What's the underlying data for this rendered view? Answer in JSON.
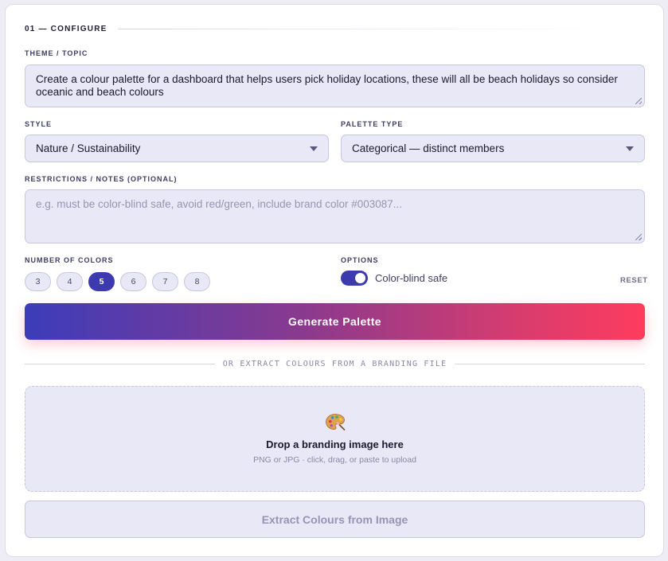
{
  "section": {
    "title": "01 — CONFIGURE"
  },
  "theme": {
    "label": "THEME / TOPIC",
    "value": "Create a colour palette for a dashboard that helps users pick holiday locations, these will all be beach holidays so consider oceanic and beach colours"
  },
  "style": {
    "label": "STYLE",
    "selected": "Nature / Sustainability"
  },
  "palette_type": {
    "label": "PALETTE TYPE",
    "selected": "Categorical — distinct members"
  },
  "restrictions": {
    "label": "RESTRICTIONS / NOTES (OPTIONAL)",
    "placeholder": "e.g. must be color-blind safe, avoid red/green, include brand color #003087..."
  },
  "num_colors": {
    "label": "NUMBER OF COLORS",
    "options": [
      "3",
      "4",
      "5",
      "6",
      "7",
      "8"
    ],
    "selected": "5"
  },
  "options": {
    "label": "OPTIONS",
    "colorblind_label": "Color-blind safe",
    "colorblind_on": true,
    "reset_label": "RESET"
  },
  "generate_label": "Generate Palette",
  "divider_text": "OR EXTRACT COLOURS FROM A BRANDING FILE",
  "dropzone": {
    "icon": "palette-icon",
    "title": "Drop a branding image here",
    "subtitle": "PNG or JPG · click, drag, or paste to upload"
  },
  "extract_label": "Extract Colours from Image",
  "colors": {
    "accent": "#3d3ab0",
    "gradient_end": "#ff3c5e",
    "field_bg": "#e9e8f6"
  }
}
